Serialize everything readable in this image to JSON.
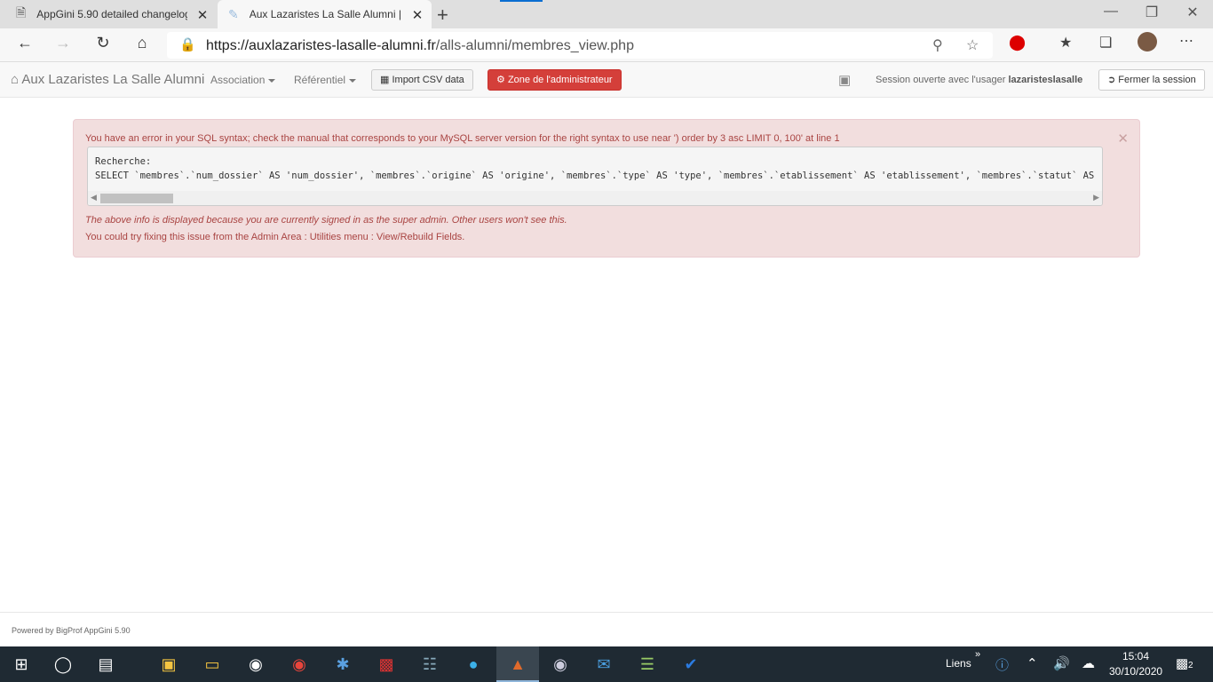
{
  "browser": {
    "tabs": [
      {
        "title": "AppGini 5.90 detailed changelog",
        "active": false
      },
      {
        "title": "Aux Lazaristes La Salle Alumni |",
        "active": true
      }
    ],
    "url_host": "https://auxlazaristes-lasalle-alumni.fr",
    "url_path": "/alls-alumni/membres_view.php"
  },
  "app": {
    "brand": "Aux Lazaristes La Salle Alumni",
    "menus": [
      "Association",
      "Référentiel"
    ],
    "import_button": "Import CSV data",
    "admin_button": "Zone de l'administrateur",
    "session_prefix": "Session ouverte avec l'usager",
    "session_user": "lazaristeslasalle",
    "logout_button": "Fermer la session"
  },
  "error": {
    "message": "You have an error in your SQL syntax; check the manual that corresponds to your MySQL server version for the right syntax to use near ') order by 3 asc LIMIT 0, 100' at line 1",
    "sql_label": "Recherche:",
    "sql_query": "SELECT `membres`.`num_dossier` AS 'num_dossier', `membres`.`origine` AS 'origine', `membres`.`type` AS 'type', `membres`.`etablissement` AS 'etablissement', `membres`.`statut` AS",
    "super_admin_note": "The above info is displayed because you are currently signed in as the super admin. Other users won't see this.",
    "fix_hint": "You could try fixing this issue from the Admin Area : Utilities menu : View/Rebuild Fields."
  },
  "footer": {
    "powered": "Powered by BigProf AppGini 5.90"
  },
  "taskbar": {
    "links_label": "Liens",
    "time": "15:04",
    "date": "30/10/2020",
    "notification_count": "2"
  }
}
